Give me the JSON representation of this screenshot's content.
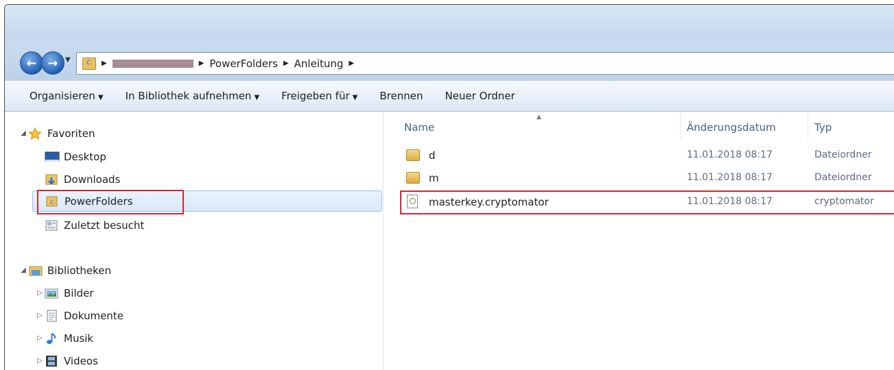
{
  "address": {
    "crumbs": [
      "PowerFolders",
      "Anleitung"
    ]
  },
  "toolbar": {
    "organize": "Organisieren",
    "include_library": "In Bibliothek aufnehmen",
    "share_with": "Freigeben für",
    "burn": "Brennen",
    "new_folder": "Neuer Ordner"
  },
  "sidebar": {
    "favorites_header": "Favoriten",
    "favorites": [
      {
        "label": "Desktop",
        "icon": "desktop-icon"
      },
      {
        "label": "Downloads",
        "icon": "downloads-folder-icon"
      },
      {
        "label": "PowerFolders",
        "icon": "powerfolders-icon",
        "selected": true
      },
      {
        "label": "Zuletzt besucht",
        "icon": "recent-places-icon"
      }
    ],
    "libraries_header": "Bibliotheken",
    "libraries": [
      {
        "label": "Bilder",
        "icon": "pictures-icon"
      },
      {
        "label": "Dokumente",
        "icon": "documents-icon"
      },
      {
        "label": "Musik",
        "icon": "music-icon"
      },
      {
        "label": "Videos",
        "icon": "videos-icon"
      }
    ]
  },
  "filelist": {
    "columns": {
      "name": "Name",
      "date": "Änderungsdatum",
      "type": "Typ"
    },
    "rows": [
      {
        "name": "d",
        "date": "11.01.2018 08:17",
        "type": "Dateiordner",
        "icon": "folder-icon"
      },
      {
        "name": "m",
        "date": "11.01.2018 08:17",
        "type": "Dateiordner",
        "icon": "folder-icon"
      },
      {
        "name": "masterkey.cryptomator",
        "date": "11.01.2018 08:17",
        "type": "cryptomator",
        "icon": "cryptomator-file-icon"
      }
    ]
  },
  "colors": {
    "highlight_box": "#d9232f",
    "selection": "#d9e8fa"
  }
}
